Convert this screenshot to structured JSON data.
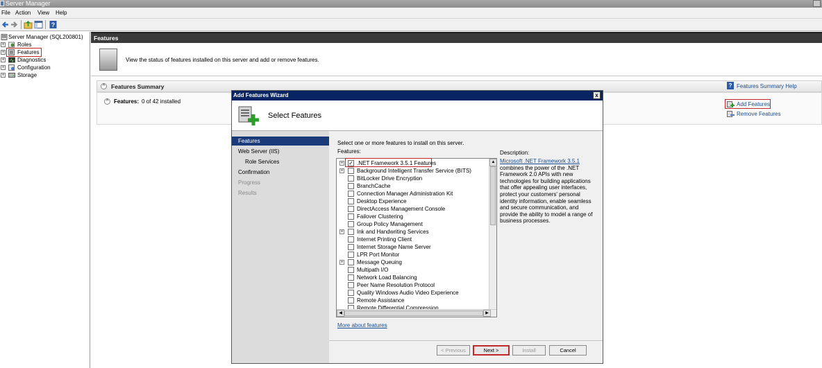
{
  "window": {
    "title": "Server Manager"
  },
  "menu": {
    "file": "File",
    "action": "Action",
    "view": "View",
    "help": "Help"
  },
  "toolbar": {
    "icons": [
      "back-arrow-icon",
      "forward-arrow-icon",
      "up-folder-icon",
      "show-hide-pane-icon",
      "help-icon"
    ]
  },
  "tree": {
    "root": "Server Manager (SQL200801)",
    "items": [
      {
        "label": "Roles",
        "icon": "roles-icon"
      },
      {
        "label": "Features",
        "icon": "features-icon"
      },
      {
        "label": "Diagnostics",
        "icon": "diagnostics-icon"
      },
      {
        "label": "Configuration",
        "icon": "configuration-icon"
      },
      {
        "label": "Storage",
        "icon": "storage-icon"
      }
    ]
  },
  "right": {
    "header": "Features",
    "banner_text": "View the status of features installed on this server and add or remove features.",
    "summary_title": "Features Summary",
    "features_label": "Features:",
    "features_value": "0 of 42 installed",
    "help_link": "Features Summary Help",
    "add_features": "Add Features",
    "remove_features": "Remove Features"
  },
  "wizard": {
    "title": "Add Features Wizard",
    "close": "x",
    "page_title": "Select Features",
    "nav": [
      {
        "label": "Features",
        "state": "active"
      },
      {
        "label": "Web Server (IIS)",
        "state": "normal"
      },
      {
        "label": "Role Services",
        "state": "sub"
      },
      {
        "label": "Confirmation",
        "state": "normal"
      },
      {
        "label": "Progress",
        "state": "disabled"
      },
      {
        "label": "Results",
        "state": "disabled"
      }
    ],
    "instruction": "Select one or more features to install on this server.",
    "features_heading": "Features:",
    "features": [
      {
        "label": ".NET Framework 3.5.1 Features",
        "checked": true,
        "expandable": true
      },
      {
        "label": "Background Intelligent Transfer Service (BITS)",
        "checked": false,
        "expandable": true
      },
      {
        "label": "BitLocker Drive Encryption",
        "checked": false,
        "expandable": false
      },
      {
        "label": "BranchCache",
        "checked": false,
        "expandable": false
      },
      {
        "label": "Connection Manager Administration Kit",
        "checked": false,
        "expandable": false
      },
      {
        "label": "Desktop Experience",
        "checked": false,
        "expandable": false
      },
      {
        "label": "DirectAccess Management Console",
        "checked": false,
        "expandable": false
      },
      {
        "label": "Failover Clustering",
        "checked": false,
        "expandable": false
      },
      {
        "label": "Group Policy Management",
        "checked": false,
        "expandable": false
      },
      {
        "label": "Ink and Handwriting Services",
        "checked": false,
        "expandable": true
      },
      {
        "label": "Internet Printing Client",
        "checked": false,
        "expandable": false
      },
      {
        "label": "Internet Storage Name Server",
        "checked": false,
        "expandable": false
      },
      {
        "label": "LPR Port Monitor",
        "checked": false,
        "expandable": false
      },
      {
        "label": "Message Queuing",
        "checked": false,
        "expandable": true
      },
      {
        "label": "Multipath I/O",
        "checked": false,
        "expandable": false
      },
      {
        "label": "Network Load Balancing",
        "checked": false,
        "expandable": false
      },
      {
        "label": "Peer Name Resolution Protocol",
        "checked": false,
        "expandable": false
      },
      {
        "label": "Quality Windows Audio Video Experience",
        "checked": false,
        "expandable": false
      },
      {
        "label": "Remote Assistance",
        "checked": false,
        "expandable": false
      },
      {
        "label": "Remote Differential Compression",
        "checked": false,
        "expandable": false
      }
    ],
    "description_label": "Description:",
    "description_link": "Microsoft .NET Framework 3.5.1",
    "description_text": "combines the power of the .NET Framework 2.0 APIs with new technologies for building applications that offer appealing user interfaces, protect your customers' personal identity information, enable seamless and secure communication, and provide the ability to model a range of business processes.",
    "more_link": "More about features",
    "buttons": {
      "previous": "< Previous",
      "next": "Next >",
      "install": "Install",
      "cancel": "Cancel"
    }
  },
  "colors": {
    "highlight": "#c0282a",
    "nav_active": "#1a3a7a",
    "wizard_title": "#082463",
    "link": "#1a4d8f"
  }
}
